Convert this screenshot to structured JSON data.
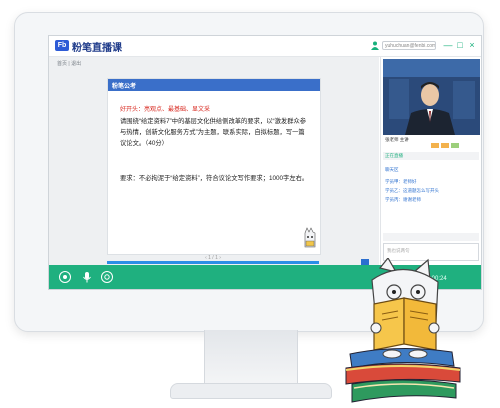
{
  "app": {
    "title": "粉笔直播课",
    "logo_text": "Fb",
    "user_email": "yuhuchuan@fenbi.com",
    "window_buttons": [
      "—",
      "□",
      "×"
    ],
    "colors": {
      "accent": "#1fb07f",
      "brand": "#2e5bd6"
    }
  },
  "content": {
    "breadcrumb": "首页 | 退出",
    "doc": {
      "brand": "粉笔公考",
      "red_heading": "好开头：亮观点、最基础、显文采",
      "para1": "请围绕“给定资料7”中的基层文化供给侧改革的要求，以“激发群众参与热情，创新文化服务方式”为主题，联系实际，自拟标题，写一篇议论文。（40分）",
      "para2": "要求：不必拘泥于“给定资料”，符合议论文写作要求；1000字左右。",
      "footer": "‹ 1 / 1 ›"
    }
  },
  "side": {
    "teacher_name": "张老师 主讲",
    "live_status": "正在直播",
    "chat_title": "聊天区",
    "chat_1": "学员甲：老师好",
    "chat_2": "学员乙：这道题怎么写开头",
    "chat_3": "学员丙：谢谢老师",
    "input_placeholder": "我也说两句"
  },
  "toolbar": {
    "icons": [
      "camera-icon",
      "mic-icon",
      "settings-icon"
    ],
    "right_text": "已开播  1:00:24"
  }
}
